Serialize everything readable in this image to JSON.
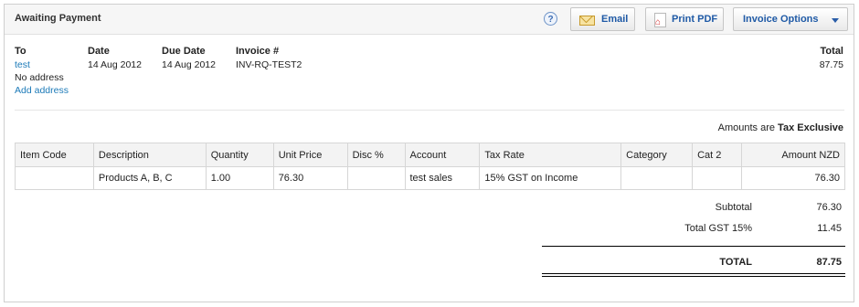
{
  "header": {
    "status": "Awaiting Payment",
    "help_glyph": "?",
    "email_label": "Email",
    "pdf_label": "Print PDF",
    "options_label": "Invoice Options"
  },
  "info": {
    "to_heading": "To",
    "to_name": "test",
    "to_address": "No address",
    "add_address": "Add address",
    "date_heading": "Date",
    "date_value": "14 Aug 2012",
    "due_heading": "Due Date",
    "due_value": "14 Aug 2012",
    "invoice_heading": "Invoice #",
    "invoice_value": "INV-RQ-TEST2",
    "total_heading": "Total",
    "total_value": "87.75"
  },
  "tax_note": {
    "prefix": "Amounts are",
    "mode": "Tax Exclusive"
  },
  "table": {
    "headers": [
      "Item Code",
      "Description",
      "Quantity",
      "Unit Price",
      "Disc %",
      "Account",
      "Tax Rate",
      "Category",
      "Cat 2",
      "Amount NZD"
    ],
    "rows": [
      [
        "",
        "Products A, B, C",
        "1.00",
        "76.30",
        "",
        "test sales",
        "15% GST on Income",
        "",
        "",
        "76.30"
      ]
    ]
  },
  "totals": {
    "subtotal_label": "Subtotal",
    "subtotal_value": "76.30",
    "gst_label": "Total GST 15%",
    "gst_value": "11.45",
    "total_label": "TOTAL",
    "total_value": "87.75"
  },
  "colors": {
    "link": "#1c7ab8",
    "button_text": "#1f5aa6"
  }
}
